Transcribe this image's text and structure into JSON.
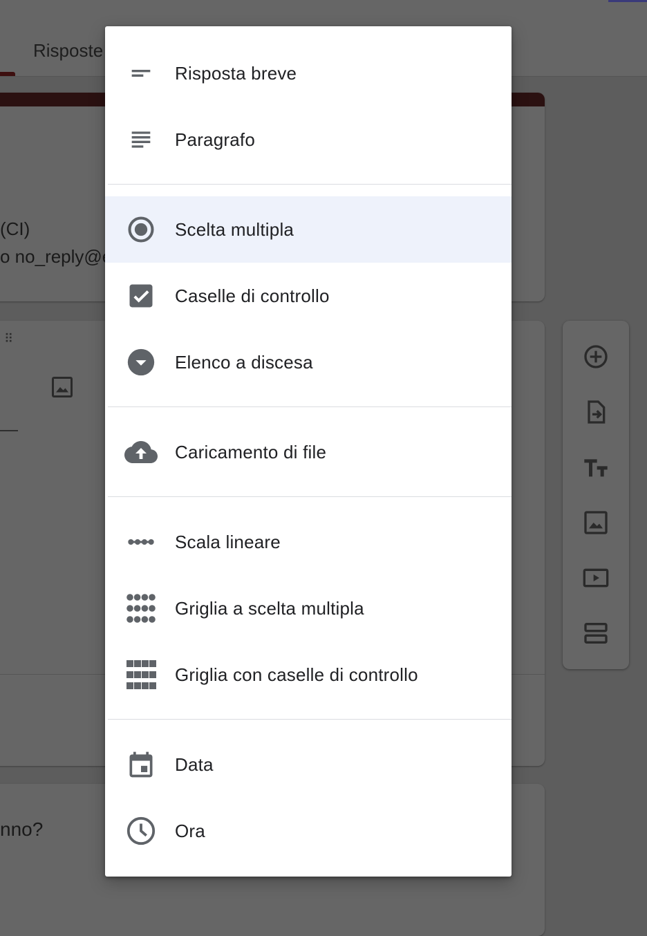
{
  "background": {
    "tab_label": "Risposte",
    "header_title_fragment": "(CI)",
    "header_email_fragment": "o no_reply@e",
    "question_fragment": "nno?",
    "drag_handle": "⠿"
  },
  "sidebar": {
    "buttons": [
      {
        "icon": "add-circle-icon"
      },
      {
        "icon": "import-questions-icon"
      },
      {
        "icon": "title-text-icon"
      },
      {
        "icon": "image-icon"
      },
      {
        "icon": "video-icon"
      },
      {
        "icon": "section-icon"
      }
    ]
  },
  "menu": {
    "items": [
      {
        "label": "Risposta breve",
        "icon": "short-answer-icon"
      },
      {
        "label": "Paragrafo",
        "icon": "paragraph-icon"
      },
      {
        "label": "Scelta multipla",
        "icon": "radio-button-icon",
        "selected": true
      },
      {
        "label": "Caselle di controllo",
        "icon": "checkbox-icon"
      },
      {
        "label": "Elenco a discesa",
        "icon": "dropdown-icon"
      },
      {
        "label": "Caricamento di file",
        "icon": "cloud-upload-icon"
      },
      {
        "label": "Scala lineare",
        "icon": "linear-scale-icon"
      },
      {
        "label": "Griglia a scelta multipla",
        "icon": "multiple-choice-grid-icon"
      },
      {
        "label": "Griglia con caselle di controllo",
        "icon": "checkbox-grid-icon"
      },
      {
        "label": "Data",
        "icon": "calendar-icon"
      },
      {
        "label": "Ora",
        "icon": "clock-icon"
      }
    ]
  },
  "colors": {
    "icon": "#5f6368",
    "selected_bg": "#eef2fb",
    "text": "#202124",
    "overlay": "#5d5d5d"
  }
}
